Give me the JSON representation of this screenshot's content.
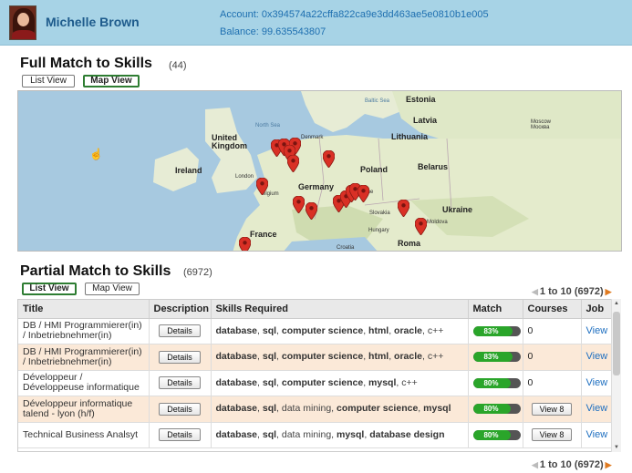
{
  "header": {
    "user_name": "Michelle Brown",
    "account": "Account: 0x394574a22cffa822ca9e3dd463ae5e0810b1e005",
    "balance": "Balance: 99.635543807"
  },
  "full_match": {
    "title": "Full Match to Skills",
    "count": "(44)",
    "list_view": "List View",
    "map_view": "Map View",
    "active_view": "map"
  },
  "map": {
    "labels": {
      "estonia": "Estonia",
      "latvia": "Latvia",
      "lithuania": "Lithuania",
      "baltic_sea": "Baltic Sea",
      "north_sea": "North Sea",
      "denmark": "Denmark",
      "united_kingdom": "United Kingdom",
      "ireland": "Ireland",
      "london": "London",
      "belgium": "elgium",
      "germany": "Germany",
      "poland": "Poland",
      "belarus": "Belarus",
      "moscow": "Moscow Москва",
      "prague": "Prague",
      "slovakia": "Slovakia",
      "ukraine": "Ukraine",
      "moldova": "Moldova",
      "hungary": "Hungary",
      "france": "France",
      "croatia": "Croatia",
      "romania": "Roma"
    },
    "pin_color": "#d93025"
  },
  "partial_match": {
    "title": "Partial Match to Skills",
    "count": "(6972)",
    "list_view": "List View",
    "map_view": "Map View",
    "active_view": "list",
    "pager": "1 to 10 (6972)",
    "pager_bottom": "1 to 10 (6972)"
  },
  "table": {
    "headers": [
      "Title",
      "Description",
      "Skills Required",
      "Match",
      "Courses",
      "Job"
    ],
    "rows": [
      {
        "title": "DB / HMI Programmierer(in) / Inbetriebnehmer(in)",
        "description": "Details",
        "skills": [
          {
            "t": "database",
            "b": true
          },
          {
            "t": ", ",
            "b": false
          },
          {
            "t": "sql",
            "b": true
          },
          {
            "t": ", ",
            "b": false
          },
          {
            "t": "computer science",
            "b": true
          },
          {
            "t": ", ",
            "b": false
          },
          {
            "t": "html",
            "b": true
          },
          {
            "t": ", ",
            "b": false
          },
          {
            "t": "oracle",
            "b": true
          },
          {
            "t": ", c++",
            "b": false
          }
        ],
        "match": "83%",
        "match_value": 83,
        "courses": "0",
        "courses_button": false,
        "job": "View"
      },
      {
        "title": "DB / HMI Programmierer(in) / Inbetriebnehmer(in)",
        "description": "Details",
        "skills": [
          {
            "t": "database",
            "b": true
          },
          {
            "t": ", ",
            "b": false
          },
          {
            "t": "sql",
            "b": true
          },
          {
            "t": ", ",
            "b": false
          },
          {
            "t": "computer science",
            "b": true
          },
          {
            "t": ", ",
            "b": false
          },
          {
            "t": "html",
            "b": true
          },
          {
            "t": ", ",
            "b": false
          },
          {
            "t": "oracle",
            "b": true
          },
          {
            "t": ", c++",
            "b": false
          }
        ],
        "match": "83%",
        "match_value": 83,
        "courses": "0",
        "courses_button": false,
        "job": "View"
      },
      {
        "title": "Développeur / Développeuse informatique",
        "description": "Details",
        "skills": [
          {
            "t": "database",
            "b": true
          },
          {
            "t": ", ",
            "b": false
          },
          {
            "t": "sql",
            "b": true
          },
          {
            "t": ", ",
            "b": false
          },
          {
            "t": "computer science",
            "b": true
          },
          {
            "t": ", ",
            "b": false
          },
          {
            "t": "mysql",
            "b": true
          },
          {
            "t": ", c++",
            "b": false
          }
        ],
        "match": "80%",
        "match_value": 80,
        "courses": "0",
        "courses_button": false,
        "job": "View"
      },
      {
        "title": "Développeur informatique talend - lyon (h/f)",
        "description": "Details",
        "skills": [
          {
            "t": "database",
            "b": true
          },
          {
            "t": ", ",
            "b": false
          },
          {
            "t": "sql",
            "b": true
          },
          {
            "t": ", data mining, ",
            "b": false
          },
          {
            "t": "computer science",
            "b": true
          },
          {
            "t": ", ",
            "b": false
          },
          {
            "t": "mysql",
            "b": true
          }
        ],
        "match": "80%",
        "match_value": 80,
        "courses": "View 8",
        "courses_button": true,
        "job": "View"
      },
      {
        "title": "Technical Business Analsyt",
        "description": "Details",
        "skills": [
          {
            "t": "database",
            "b": true
          },
          {
            "t": ", ",
            "b": false
          },
          {
            "t": "sql",
            "b": true
          },
          {
            "t": ", data mining, ",
            "b": false
          },
          {
            "t": "mysql",
            "b": true
          },
          {
            "t": ", ",
            "b": false
          },
          {
            "t": "database design",
            "b": true
          }
        ],
        "match": "80%",
        "match_value": 80,
        "courses": "View 8",
        "courses_button": true,
        "job": "View"
      }
    ]
  }
}
